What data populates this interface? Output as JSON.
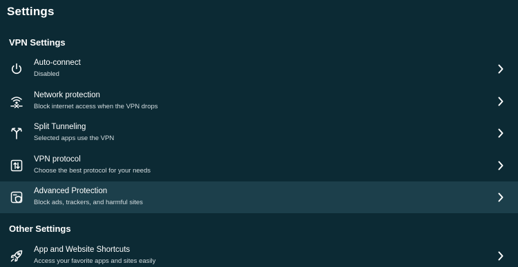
{
  "header": {
    "title": "Settings"
  },
  "vpn_section": {
    "title": "VPN Settings",
    "items": [
      {
        "title": "Auto-connect",
        "subtitle": "Disabled",
        "icon": "power-icon"
      },
      {
        "title": "Network protection",
        "subtitle": "Block internet access when the VPN drops",
        "icon": "network-protection-icon"
      },
      {
        "title": "Split Tunneling",
        "subtitle": "Selected apps use the VPN",
        "icon": "split-tunnel-icon"
      },
      {
        "title": "VPN protocol",
        "subtitle": "Choose the best protocol for your needs",
        "icon": "protocol-icon"
      },
      {
        "title": "Advanced Protection",
        "subtitle": "Block ads, trackers, and harmful sites",
        "icon": "shield-icon",
        "selected": true
      }
    ]
  },
  "other_section": {
    "title": "Other Settings",
    "items": [
      {
        "title": "App and Website Shortcuts",
        "subtitle": "Access your favorite apps and sites easily",
        "icon": "rocket-icon"
      }
    ]
  },
  "colors": {
    "background": "#0c2a34",
    "selected_row": "#1c3f4b",
    "text": "#ffffff",
    "subtext": "#d4dde0"
  }
}
